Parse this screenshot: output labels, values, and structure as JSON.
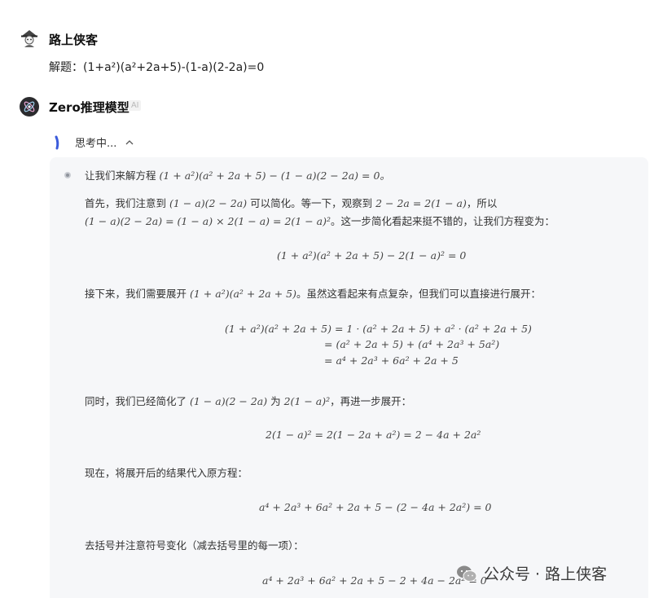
{
  "user": {
    "name": "路上侠客",
    "message": "解题：(1+a²)(a²+2a+5)-(1-a)(2-2a)=0"
  },
  "bot": {
    "name": "Zero推理模型",
    "badge": "AI"
  },
  "thinking": {
    "label": "思考中..."
  },
  "reasoning": {
    "p1_text": "让我们来解方程",
    "p1_math": "(1 + a²)(a² + 2a + 5) − (1 − a)(2 − 2a) = 0。",
    "p2_a": "首先，我们注意到",
    "p2_math1": "(1 − a)(2 − 2a)",
    "p2_b": "可以简化。等一下，观察到",
    "p2_math2": "2 − 2a = 2(1 − a)",
    "p2_c": "，所以",
    "p3_math": "(1 − a)(2 − 2a) = (1 − a) × 2(1 − a) = 2(1 − a)²",
    "p3_text": "。这一步简化看起来挺不错的，让我们方程变为：",
    "eq1": "(1 + a²)(a² + 2a + 5) − 2(1 − a)² = 0",
    "p4_a": "接下来，我们需要展开",
    "p4_math": "(1 + a²)(a² + 2a + 5)",
    "p4_b": "。虽然这看起来有点复杂，但我们可以直接进行展开：",
    "eq2_l1": "(1 + a²)(a² + 2a + 5) = 1 · (a² + 2a + 5) + a² · (a² + 2a + 5)",
    "eq2_l2": "= (a² + 2a + 5) + (a⁴ + 2a³ + 5a²)",
    "eq2_l3": "= a⁴ + 2a³ + 6a² + 2a + 5",
    "p5_a": "同时，我们已经简化了",
    "p5_math1": "(1 − a)(2 − 2a)",
    "p5_b": "为",
    "p5_math2": "2(1 − a)²",
    "p5_c": "，再进一步展开：",
    "eq3": "2(1 − a)² = 2(1 − 2a + a²) = 2 − 4a + 2a²",
    "p6": "现在，将展开后的结果代入原方程：",
    "eq4": "a⁴ + 2a³ + 6a² + 2a + 5 − (2 − 4a + 2a²) = 0",
    "p7": "去括号并注意符号变化（减去括号里的每一项）：",
    "eq5": "a⁴ + 2a³ + 6a² + 2a + 5 − 2 + 4a − 2a² = 0"
  },
  "watermark": {
    "text": "公众号 · 路上侠客"
  }
}
